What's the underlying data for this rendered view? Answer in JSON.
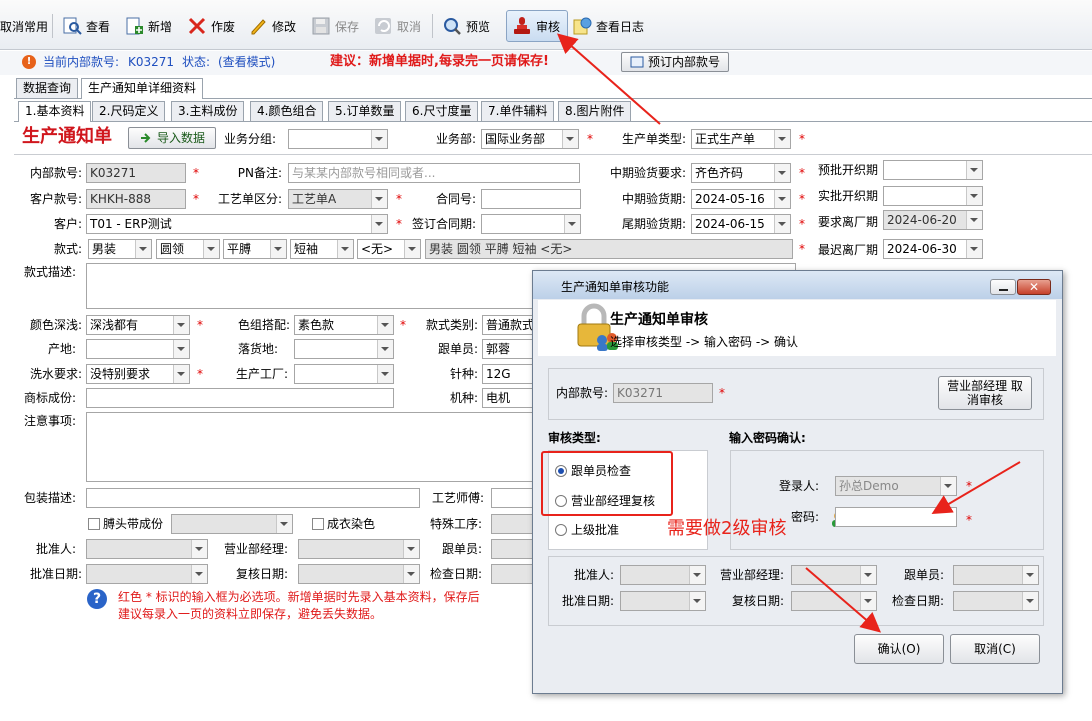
{
  "toolbar": {
    "cancel_common": "取消常用",
    "view": "查看",
    "add": "新增",
    "void": "作废",
    "edit": "修改",
    "save": "保存",
    "cancel": "取消",
    "preview": "预览",
    "audit": "审核",
    "view_log": "查看日志"
  },
  "status": {
    "current_code_label": "当前内部款号:",
    "current_code": "K03271",
    "state_label": "状态:",
    "state_value": "(查看模式)",
    "advice": "建议：新增单据时,每录完一页请保存!",
    "reserve_btn": "预订内部款号"
  },
  "outer_tabs": [
    "数据查询",
    "生产通知单详细资料"
  ],
  "inner_tabs": [
    "1.基本资料",
    "2.尺码定义",
    "3.主料成份",
    "4.颜色组合",
    "5.订单数量",
    "6.尺寸度量",
    "7.单件辅料",
    "8.图片附件"
  ],
  "form": {
    "title": "生产通知单",
    "import_btn": "导入数据",
    "biz_group_label": "业务分组:",
    "biz_dept_label": "业务部:",
    "biz_dept": "国际业务部",
    "order_type_label": "生产单类型:",
    "order_type": "正式生产单",
    "code_label": "内部款号:",
    "code": "K03271",
    "pn_label": "PN备注:",
    "pn_placeholder": "与某某内部款号相同或者...",
    "mid_req_label": "中期验货要求:",
    "mid_req": "齐色齐码",
    "pre_open_label": "预批开织期",
    "cust_code_label": "客户款号:",
    "cust_code": "KHKH-888",
    "craft_label": "工艺单区分:",
    "craft": "工艺单A",
    "contract_label": "合同号:",
    "mid_date_label": "中期验货期:",
    "mid_date": "2024-05-16",
    "real_open_label": "实批开织期",
    "customer_label": "客户:",
    "customer": "T01 - ERP测试",
    "sign_date_label": "签订合同期:",
    "final_date_label": "尾期验货期:",
    "final_date": "2024-06-15",
    "req_leave_label": "要求离厂期",
    "req_leave": "2024-06-20",
    "style_label": "款式:",
    "style_opts": [
      "男装",
      "圆领",
      "平膊",
      "短袖",
      "<无>"
    ],
    "style_summary": "男装  圆领  平膊  短袖 <无>",
    "latest_leave_label": "最迟离厂期",
    "latest_leave": "2024-06-30",
    "style_desc_label": "款式描述:",
    "color_depth_label": "颜色深浅:",
    "color_depth": "深浅都有",
    "color_match_label": "色组搭配:",
    "color_match": "素色款",
    "style_type_label": "款式类别:",
    "style_type": "普通款式",
    "origin_label": "产地:",
    "drop_label": "落货地:",
    "follower_label": "跟单员:",
    "follower": "郭蓉",
    "wash_label": "洗水要求:",
    "wash": "没特别要求",
    "factory_label": "生产工厂:",
    "needle_label": "针种:",
    "needle": "12G",
    "brand_label": "商标成份:",
    "machine_label": "机种:",
    "machine": "电机",
    "notes_label": "注意事项:",
    "pack_label": "包装描述:",
    "craftsman_label": "工艺师傅:",
    "cb1_label": "膊头带成份",
    "cb2_label": "成衣染色",
    "special_label": "特殊工序:",
    "approver_label": "批准人:",
    "biz_mgr_label": "营业部经理:",
    "follower2_label": "跟单员:",
    "approve_date_label": "批准日期:",
    "review_date_label": "复核日期:",
    "check_date_label": "检查日期:",
    "hint_line1": "红色 * 标识的输入框为必选项。新增单据时先录入基本资料，保存后",
    "hint_line2": "建议每录入一页的资料立即保存，避免丢失数据。"
  },
  "dialog": {
    "title": "生产通知单审核功能",
    "heading": "生产通知单审核",
    "steps": "选择审核类型 -> 输入密码 -> 确认",
    "code_label": "内部款号:",
    "code": "K03271",
    "cancel_audit_btn": "营业部经理 取消审核",
    "audit_type_label": "审核类型:",
    "options": [
      "跟单员检查",
      "营业部经理复核",
      "上级批准"
    ],
    "pwd_section": "输入密码确认:",
    "login_label": "登录人:",
    "login_user": "孙总Demo",
    "pwd_label": "密码:",
    "approver_label": "批准人:",
    "biz_mgr_label": "营业部经理:",
    "follower_label": "跟单员:",
    "approve_date_label": "批准日期:",
    "review_date_label": "复核日期:",
    "check_date_label": "检查日期:",
    "ok_btn": "确认(O)",
    "cancel_btn": "取消(C)"
  },
  "annotation": {
    "text": "需要做2级审核",
    "color": "#e8231b"
  }
}
